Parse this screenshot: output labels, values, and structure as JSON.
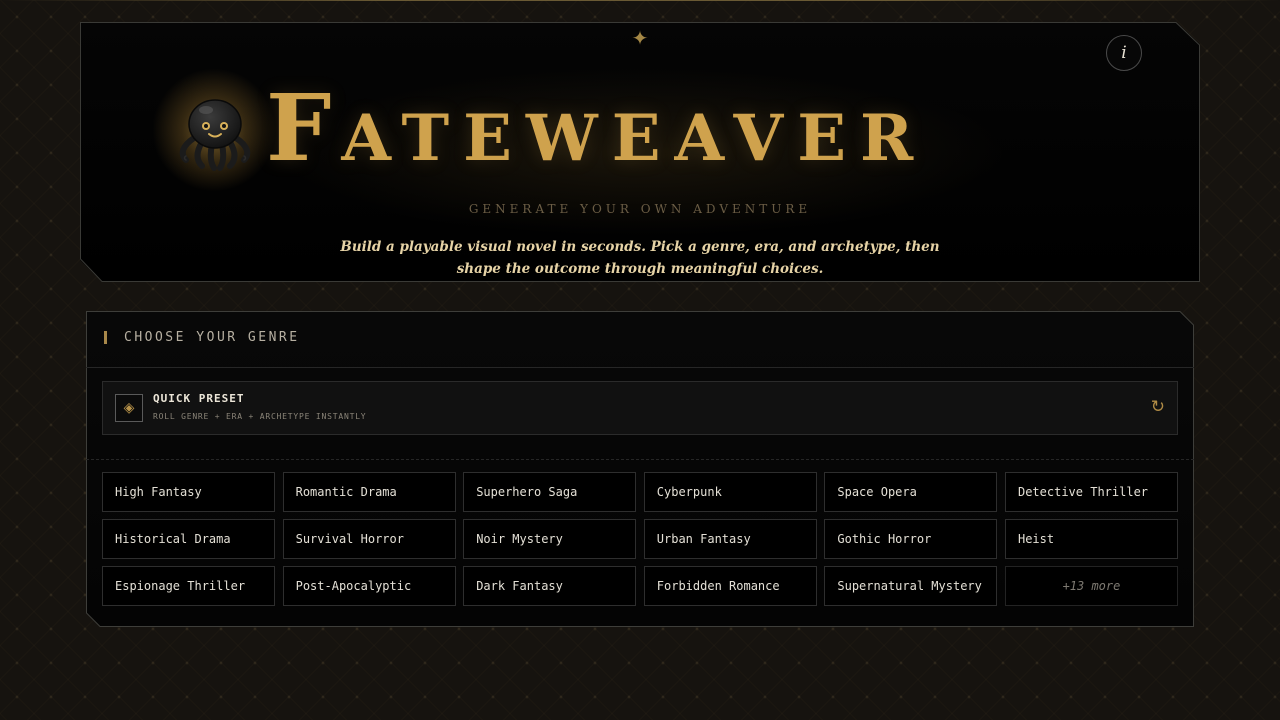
{
  "hero": {
    "title_first_letter": "F",
    "title_rest": "ATEWEAVER",
    "tagline": "GENERATE YOUR OWN ADVENTURE",
    "intro": "Build a playable visual novel in seconds. Pick a genre, era, and archetype, then shape the outcome through meaningful choices.",
    "info_label": "i",
    "star_glyph": "✦",
    "mascot_icon": "octopus-icon"
  },
  "genre_panel": {
    "title": "CHOOSE YOUR GENRE",
    "preset": {
      "icon": "diamond-icon",
      "icon_glyph": "◈",
      "title": "QUICK PRESET",
      "subtitle": "ROLL GENRE + ERA + ARCHETYPE INSTANTLY",
      "reroll_glyph": "↻"
    },
    "genres": [
      "High Fantasy",
      "Romantic Drama",
      "Superhero Saga",
      "Cyberpunk",
      "Space Opera",
      "Detective Thriller",
      "Historical Drama",
      "Survival Horror",
      "Noir Mystery",
      "Urban Fantasy",
      "Gothic Horror",
      "Heist",
      "Espionage Thriller",
      "Post-Apocalyptic",
      "Dark Fantasy",
      "Forbidden Romance",
      "Supernatural Mystery"
    ],
    "more_label": "+13 more"
  },
  "colors": {
    "accent_gold": "#cfa24d",
    "background": "#16130f",
    "panel": "#050505"
  }
}
